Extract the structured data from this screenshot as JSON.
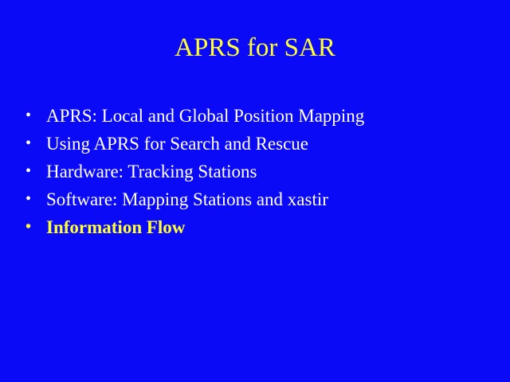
{
  "slide": {
    "title": "APRS for SAR",
    "bullet_glyph": "•",
    "items": [
      {
        "text": "APRS: Local and Global Position Mapping",
        "highlighted": false
      },
      {
        "text": "Using APRS for Search and Rescue",
        "highlighted": false
      },
      {
        "text": "Hardware: Tracking Stations",
        "highlighted": false
      },
      {
        "text": "Software: Mapping Stations and xastir",
        "highlighted": false
      },
      {
        "text": "Information Flow",
        "highlighted": true
      }
    ]
  },
  "colors": {
    "background": "#0a0af7",
    "title": "#ffff33",
    "body_text": "#ffffff",
    "highlight": "#ffff33"
  }
}
